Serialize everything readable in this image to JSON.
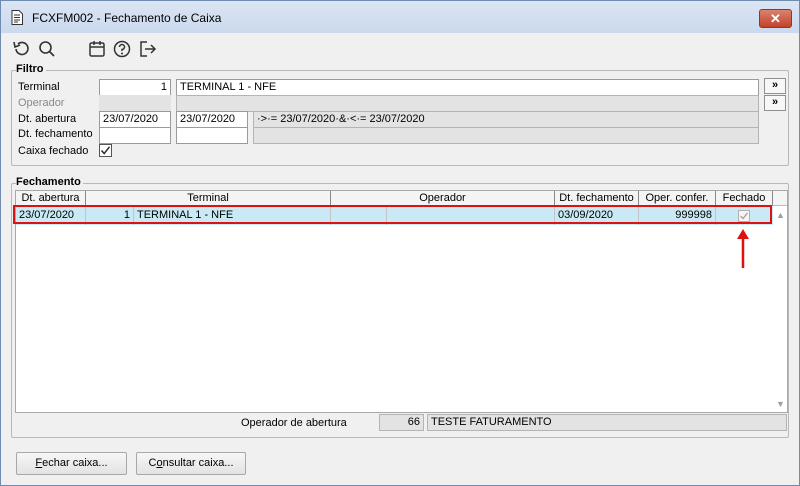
{
  "window": {
    "title": "FCXFM002 - Fechamento de Caixa",
    "close_glyph": "✕"
  },
  "toolbar": {
    "icons": [
      "undo-icon",
      "search-icon",
      "calendar-icon",
      "help-icon",
      "exit-icon"
    ]
  },
  "filter": {
    "title": "Filtro",
    "terminal_label": "Terminal",
    "terminal_code": "1",
    "terminal_name": "TERMINAL 1 - NFE",
    "operador_label": "Operador",
    "operador_code": "",
    "operador_name": "",
    "abertura_label": "Dt. abertura",
    "abertura_from": "23/07/2020",
    "abertura_to": "23/07/2020",
    "abertura_expr": "·>·= 23/07/2020·&·<·= 23/07/2020",
    "fechamento_label": "Dt. fechamento",
    "fechamento_from": "",
    "fechamento_to": "",
    "fechamento_expr": "",
    "caixa_fechado_label": "Caixa fechado",
    "caixa_fechado_checked": true,
    "expand_glyph": "»"
  },
  "fechamento": {
    "title": "Fechamento",
    "columns": [
      "Dt. abertura",
      "Terminal",
      "Operador",
      "Dt. fechamento",
      "Oper. confer.",
      "Fechado"
    ],
    "rows": [
      {
        "dt_abertura": "23/07/2020",
        "terminal_code": "1",
        "terminal_name": "TERMINAL 1 - NFE",
        "operador_code": "",
        "operador_name": "",
        "dt_fechamento": "03/09/2020",
        "oper_confer": "999998",
        "fechado": true
      }
    ],
    "operador_abertura_label": "Operador de abertura",
    "operador_abertura_code": "66",
    "operador_abertura_name": "TESTE FATURAMENTO"
  },
  "buttons": {
    "fechar_first": "F",
    "fechar_rest": "echar caixa...",
    "consultar_pre": "C",
    "consultar_u": "o",
    "consultar_rest": "nsultar caixa..."
  },
  "colors": {
    "highlight": "#dd1111",
    "row_selected": "#c9eaf4"
  }
}
